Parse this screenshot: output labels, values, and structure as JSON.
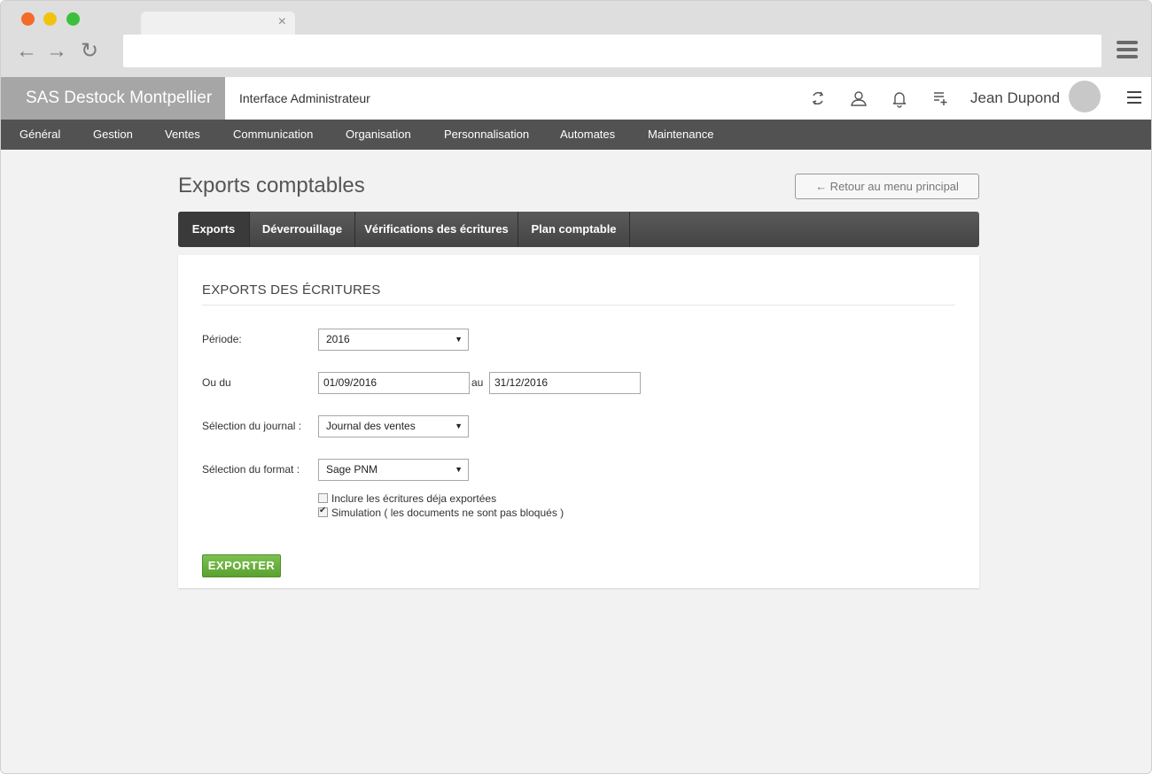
{
  "browser": {
    "tab_close": "×",
    "nav_back": "←",
    "nav_forward": "→",
    "nav_reload": "↻"
  },
  "header": {
    "brand": "SAS Destock Montpellier",
    "subtitle": "Interface Administrateur",
    "icons": [
      "sync-icon",
      "users-icon",
      "bell-icon",
      "add-list-icon"
    ],
    "user_name": "Jean Dupond"
  },
  "main_nav": [
    "Général",
    "Gestion",
    "Ventes",
    "Communication",
    "Organisation",
    "Personnalisation",
    "Automates",
    "Maintenance"
  ],
  "page": {
    "title": "Exports comptables",
    "back_label": "← Retour au menu principal"
  },
  "tabs": [
    "Exports",
    "Déverrouillage",
    "Vérifications des écritures",
    "Plan comptable"
  ],
  "active_tab": "Exports",
  "form": {
    "section_title": "EXPORTS DES ÉCRITURES",
    "periode_label": "Période:",
    "periode_value": "2016",
    "ou_du_label": "Ou du",
    "date_from": "01/09/2016",
    "au_label": "au",
    "date_to": "31/12/2016",
    "journal_label": "Sélection du journal :",
    "journal_value": "Journal des ventes",
    "format_label": "Sélection du format :",
    "format_value": "Sage PNM",
    "checkbox_include_label": "Inclure les écritures déja exportées",
    "checkbox_include_checked": false,
    "checkbox_simulation_label": "Simulation ( les documents ne sont pas bloqués )",
    "checkbox_simulation_checked": true,
    "caret": "▼",
    "export_button": "EXPORTER"
  },
  "colors": {
    "brand_bg": "#a6a6a6",
    "nav_bg": "#525252",
    "tabbar_bg": "#4e4e4e",
    "export_green": "#6cb23f"
  }
}
